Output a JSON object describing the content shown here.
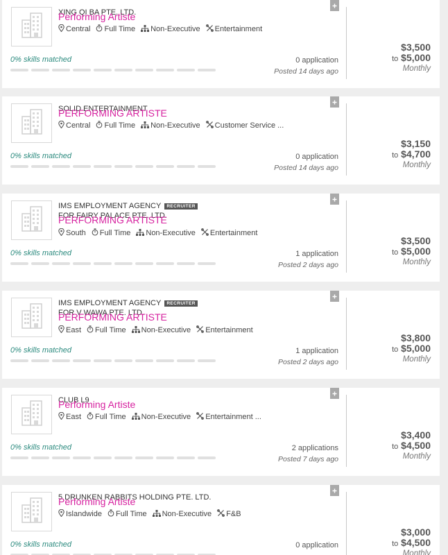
{
  "jobs": [
    {
      "company": "XING QI BA PTE. LTD.",
      "recruiter_badge": "",
      "for_line": "",
      "title": "Performing Artiste",
      "location": "Central",
      "employment_type": "Full Time",
      "level": "Non-Executive",
      "category": "Entertainment",
      "skills_matched": "0% skills matched",
      "applications": "0 application",
      "posted": "Posted 14 days ago",
      "salary_from": "$3,500",
      "salary_to_label": "to",
      "salary_to": "$5,000",
      "salary_period": "Monthly"
    },
    {
      "company": "SOLID ENTERTAINMENT",
      "recruiter_badge": "",
      "for_line": "",
      "title": "PERFORMING ARTISTE",
      "location": "Central",
      "employment_type": "Full Time",
      "level": "Non-Executive",
      "category": "Customer Service ...",
      "skills_matched": "0% skills matched",
      "applications": "0 application",
      "posted": "Posted 14 days ago",
      "salary_from": "$3,150",
      "salary_to_label": "to",
      "salary_to": "$4,700",
      "salary_period": "Monthly"
    },
    {
      "company": "IMS EMPLOYMENT AGENCY",
      "recruiter_badge": "RECRUITER",
      "for_line": "for FAIRY PALACE PTE. LTD.",
      "title": "PERFORMING ARTISTE",
      "location": "South",
      "employment_type": "Full Time",
      "level": "Non-Executive",
      "category": "Entertainment",
      "skills_matched": "0% skills matched",
      "applications": "1 application",
      "posted": "Posted 2 days ago",
      "salary_from": "$3,500",
      "salary_to_label": "to",
      "salary_to": "$5,000",
      "salary_period": "Monthly"
    },
    {
      "company": "IMS EMPLOYMENT AGENCY",
      "recruiter_badge": "RECRUITER",
      "for_line": "for V WAWA PTE. LTD.",
      "title": "PERFORMING ARTISTE",
      "location": "East",
      "employment_type": "Full Time",
      "level": "Non-Executive",
      "category": "Entertainment",
      "skills_matched": "0% skills matched",
      "applications": "1 application",
      "posted": "Posted 2 days ago",
      "salary_from": "$3,800",
      "salary_to_label": "to",
      "salary_to": "$5,000",
      "salary_period": "Monthly"
    },
    {
      "company": "CLUB L9",
      "recruiter_badge": "",
      "for_line": "",
      "title": "Performing Artiste",
      "location": "East",
      "employment_type": "Full Time",
      "level": "Non-Executive",
      "category": "Entertainment ...",
      "skills_matched": "0% skills matched",
      "applications": "2 applications",
      "posted": "Posted 7 days ago",
      "salary_from": "$3,400",
      "salary_to_label": "to",
      "salary_to": "$4,500",
      "salary_period": "Monthly"
    },
    {
      "company": "5 DRUNKEN RABBITS HOLDING PTE. LTD.",
      "recruiter_badge": "",
      "for_line": "",
      "title": "Performing Artiste",
      "location": "Islandwide",
      "employment_type": "Full Time",
      "level": "Non-Executive",
      "category": "F&B",
      "skills_matched": "0% skills matched",
      "applications": "0 application",
      "posted": "",
      "salary_from": "$3,000",
      "salary_to_label": "to",
      "salary_to": "$4,500",
      "salary_period": "Monthly"
    }
  ],
  "icons": {
    "logo": "building-icon",
    "bookmark": "bookmark-icon",
    "location": "location-pin-icon",
    "employment_type": "stopwatch-icon",
    "level": "hierarchy-icon",
    "category": "tools-icon"
  },
  "colors": {
    "title": "#d6219f",
    "skills": "#2b8a7e",
    "bookmark": "#a9a9a9"
  }
}
